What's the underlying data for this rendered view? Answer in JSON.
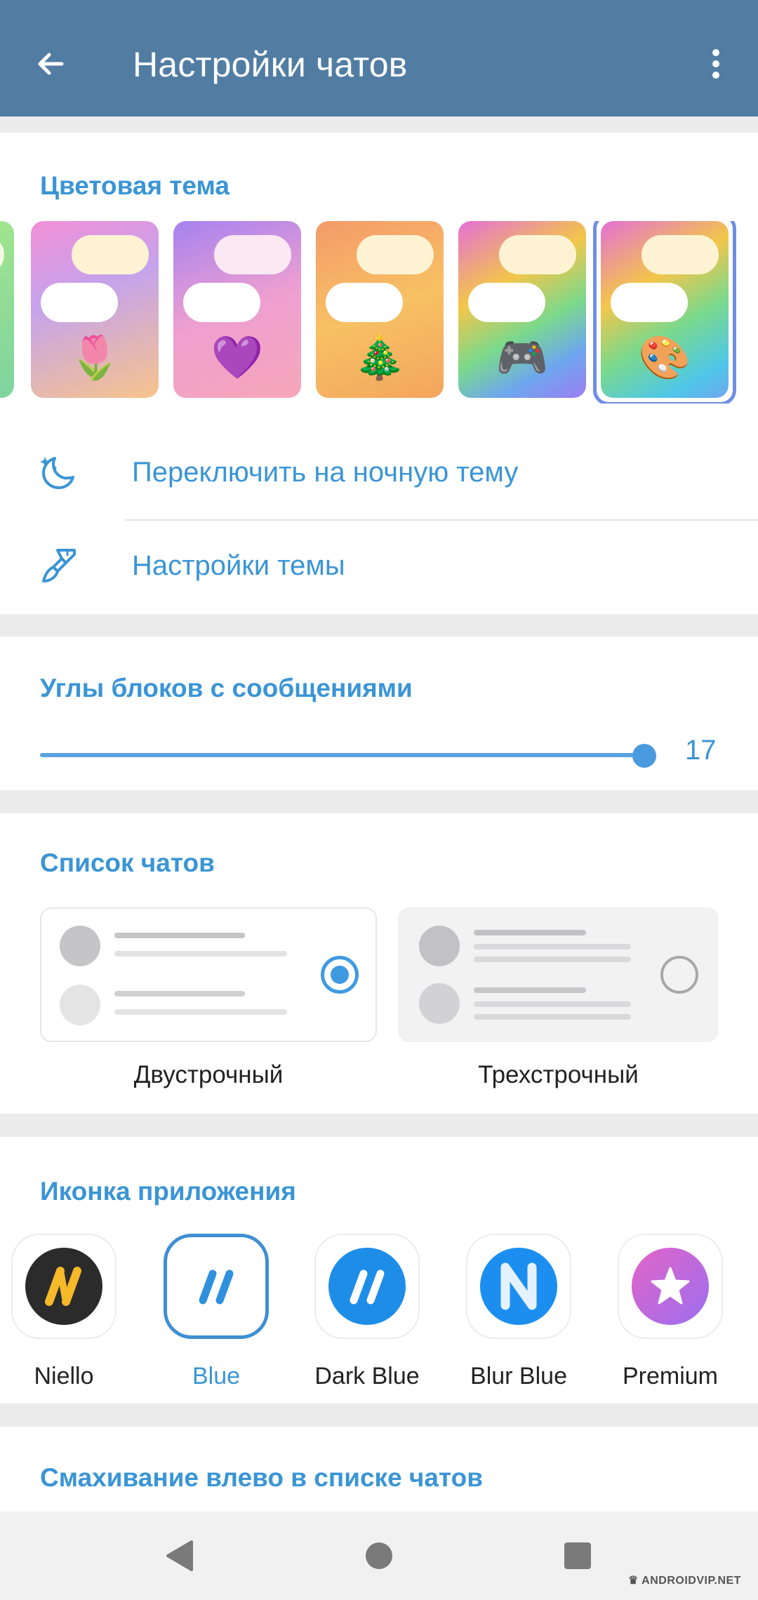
{
  "appbar": {
    "title": "Настройки чатов",
    "back_icon": "arrow-left-icon",
    "more_icon": "more-vertical-icon"
  },
  "color_theme": {
    "title": "Цветовая тема",
    "themes": [
      {
        "id": "green",
        "emoji": ""
      },
      {
        "id": "tulip",
        "emoji": "🌷"
      },
      {
        "id": "heart",
        "emoji": "💜"
      },
      {
        "id": "tree",
        "emoji": "🎄"
      },
      {
        "id": "gamepad",
        "emoji": "🎮"
      },
      {
        "id": "palette",
        "emoji": "🎨",
        "selected": true
      }
    ],
    "night_mode_label": "Переключить на ночную тему",
    "theme_settings_label": "Настройки темы"
  },
  "corners": {
    "title": "Углы блоков с сообщениями",
    "value": "17",
    "fraction": 1.0
  },
  "chat_list": {
    "title": "Список чатов",
    "options": [
      {
        "label": "Двустрочный",
        "selected": true
      },
      {
        "label": "Трехстрочный",
        "selected": false
      }
    ]
  },
  "app_icon": {
    "title": "Иконка приложения",
    "icons": [
      {
        "label": "Niello",
        "selected": false
      },
      {
        "label": "Blue",
        "selected": true
      },
      {
        "label": "Dark Blue",
        "selected": false
      },
      {
        "label": "Blur Blue",
        "selected": false
      },
      {
        "label": "Premium",
        "selected": false
      }
    ]
  },
  "swipe": {
    "title": "Смахивание влево в списке чатов"
  },
  "navbar": {
    "back": "triangle-back-icon",
    "home": "circle-home-icon",
    "recents": "square-recents-icon",
    "watermark": "ANDROIDVIP.NET"
  },
  "colors": {
    "header": "#527da3",
    "accent": "#3a95d5"
  }
}
